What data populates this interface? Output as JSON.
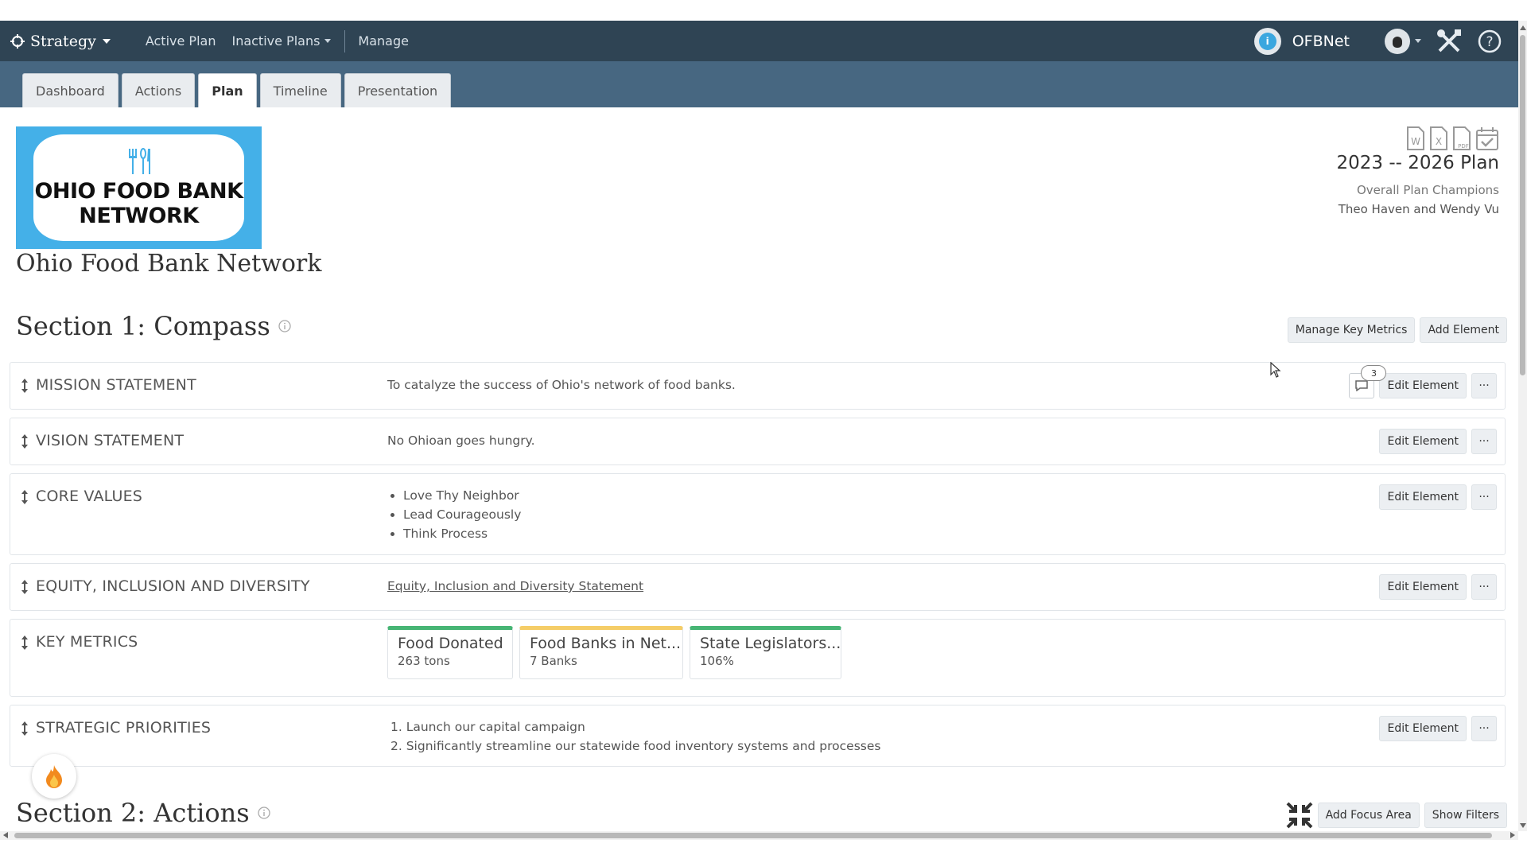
{
  "nav": {
    "brand": "Strategy",
    "links": [
      "Active Plan",
      "Inactive Plans",
      "Manage"
    ],
    "org_name": "OFBNet"
  },
  "tabs": [
    "Dashboard",
    "Actions",
    "Plan",
    "Timeline",
    "Presentation"
  ],
  "active_tab": "Plan",
  "header": {
    "logo_text": [
      "OHIO FOOD BANK",
      "NETWORK"
    ],
    "org_title": "Ohio Food Bank Network",
    "plan_title": "2023 -- 2026 Plan",
    "champions_label": "Overall Plan Champions",
    "champions": "Theo Haven and Wendy Vu",
    "export_icons": [
      "word-icon",
      "excel-icon",
      "pdf-icon",
      "calendar-check-icon"
    ]
  },
  "section1": {
    "title": "Section 1: Compass",
    "buttons": [
      "Manage Key Metrics",
      "Add Element"
    ]
  },
  "elements": {
    "edit_label": "Edit Element",
    "more_label": "···",
    "mission": {
      "label": "MISSION STATEMENT",
      "text": "To catalyze the success of Ohio's network of food banks.",
      "comments": "3"
    },
    "vision": {
      "label": "VISION STATEMENT",
      "text": "No Ohioan goes hungry."
    },
    "values": {
      "label": "CORE VALUES",
      "items": [
        "Love Thy Neighbor",
        "Lead Courageously",
        "Think Process"
      ]
    },
    "equity": {
      "label": "EQUITY, INCLUSION AND DIVERSITY",
      "link": "Equity, Inclusion and Diversity Statement"
    },
    "metrics": {
      "label": "KEY METRICS",
      "items": [
        {
          "name": "Food Donated",
          "value": "263 tons",
          "color": "#46b574"
        },
        {
          "name": "Food Banks in Net...",
          "value": "7 Banks",
          "color": "#f5cd67"
        },
        {
          "name": "State Legislators...",
          "value": "106%",
          "color": "#46b574"
        }
      ]
    },
    "priorities": {
      "label": "STRATEGIC PRIORITIES",
      "items": [
        "1. Launch our capital campaign",
        "2. Significantly streamline our statewide food inventory systems and processes"
      ]
    }
  },
  "section2": {
    "title": "Section 2: Actions",
    "buttons": [
      "Add Focus Area",
      "Show Filters"
    ]
  },
  "colors": {
    "navbar": "#2f4454",
    "tabband": "#476781",
    "logo_bg": "#44b0e8"
  }
}
